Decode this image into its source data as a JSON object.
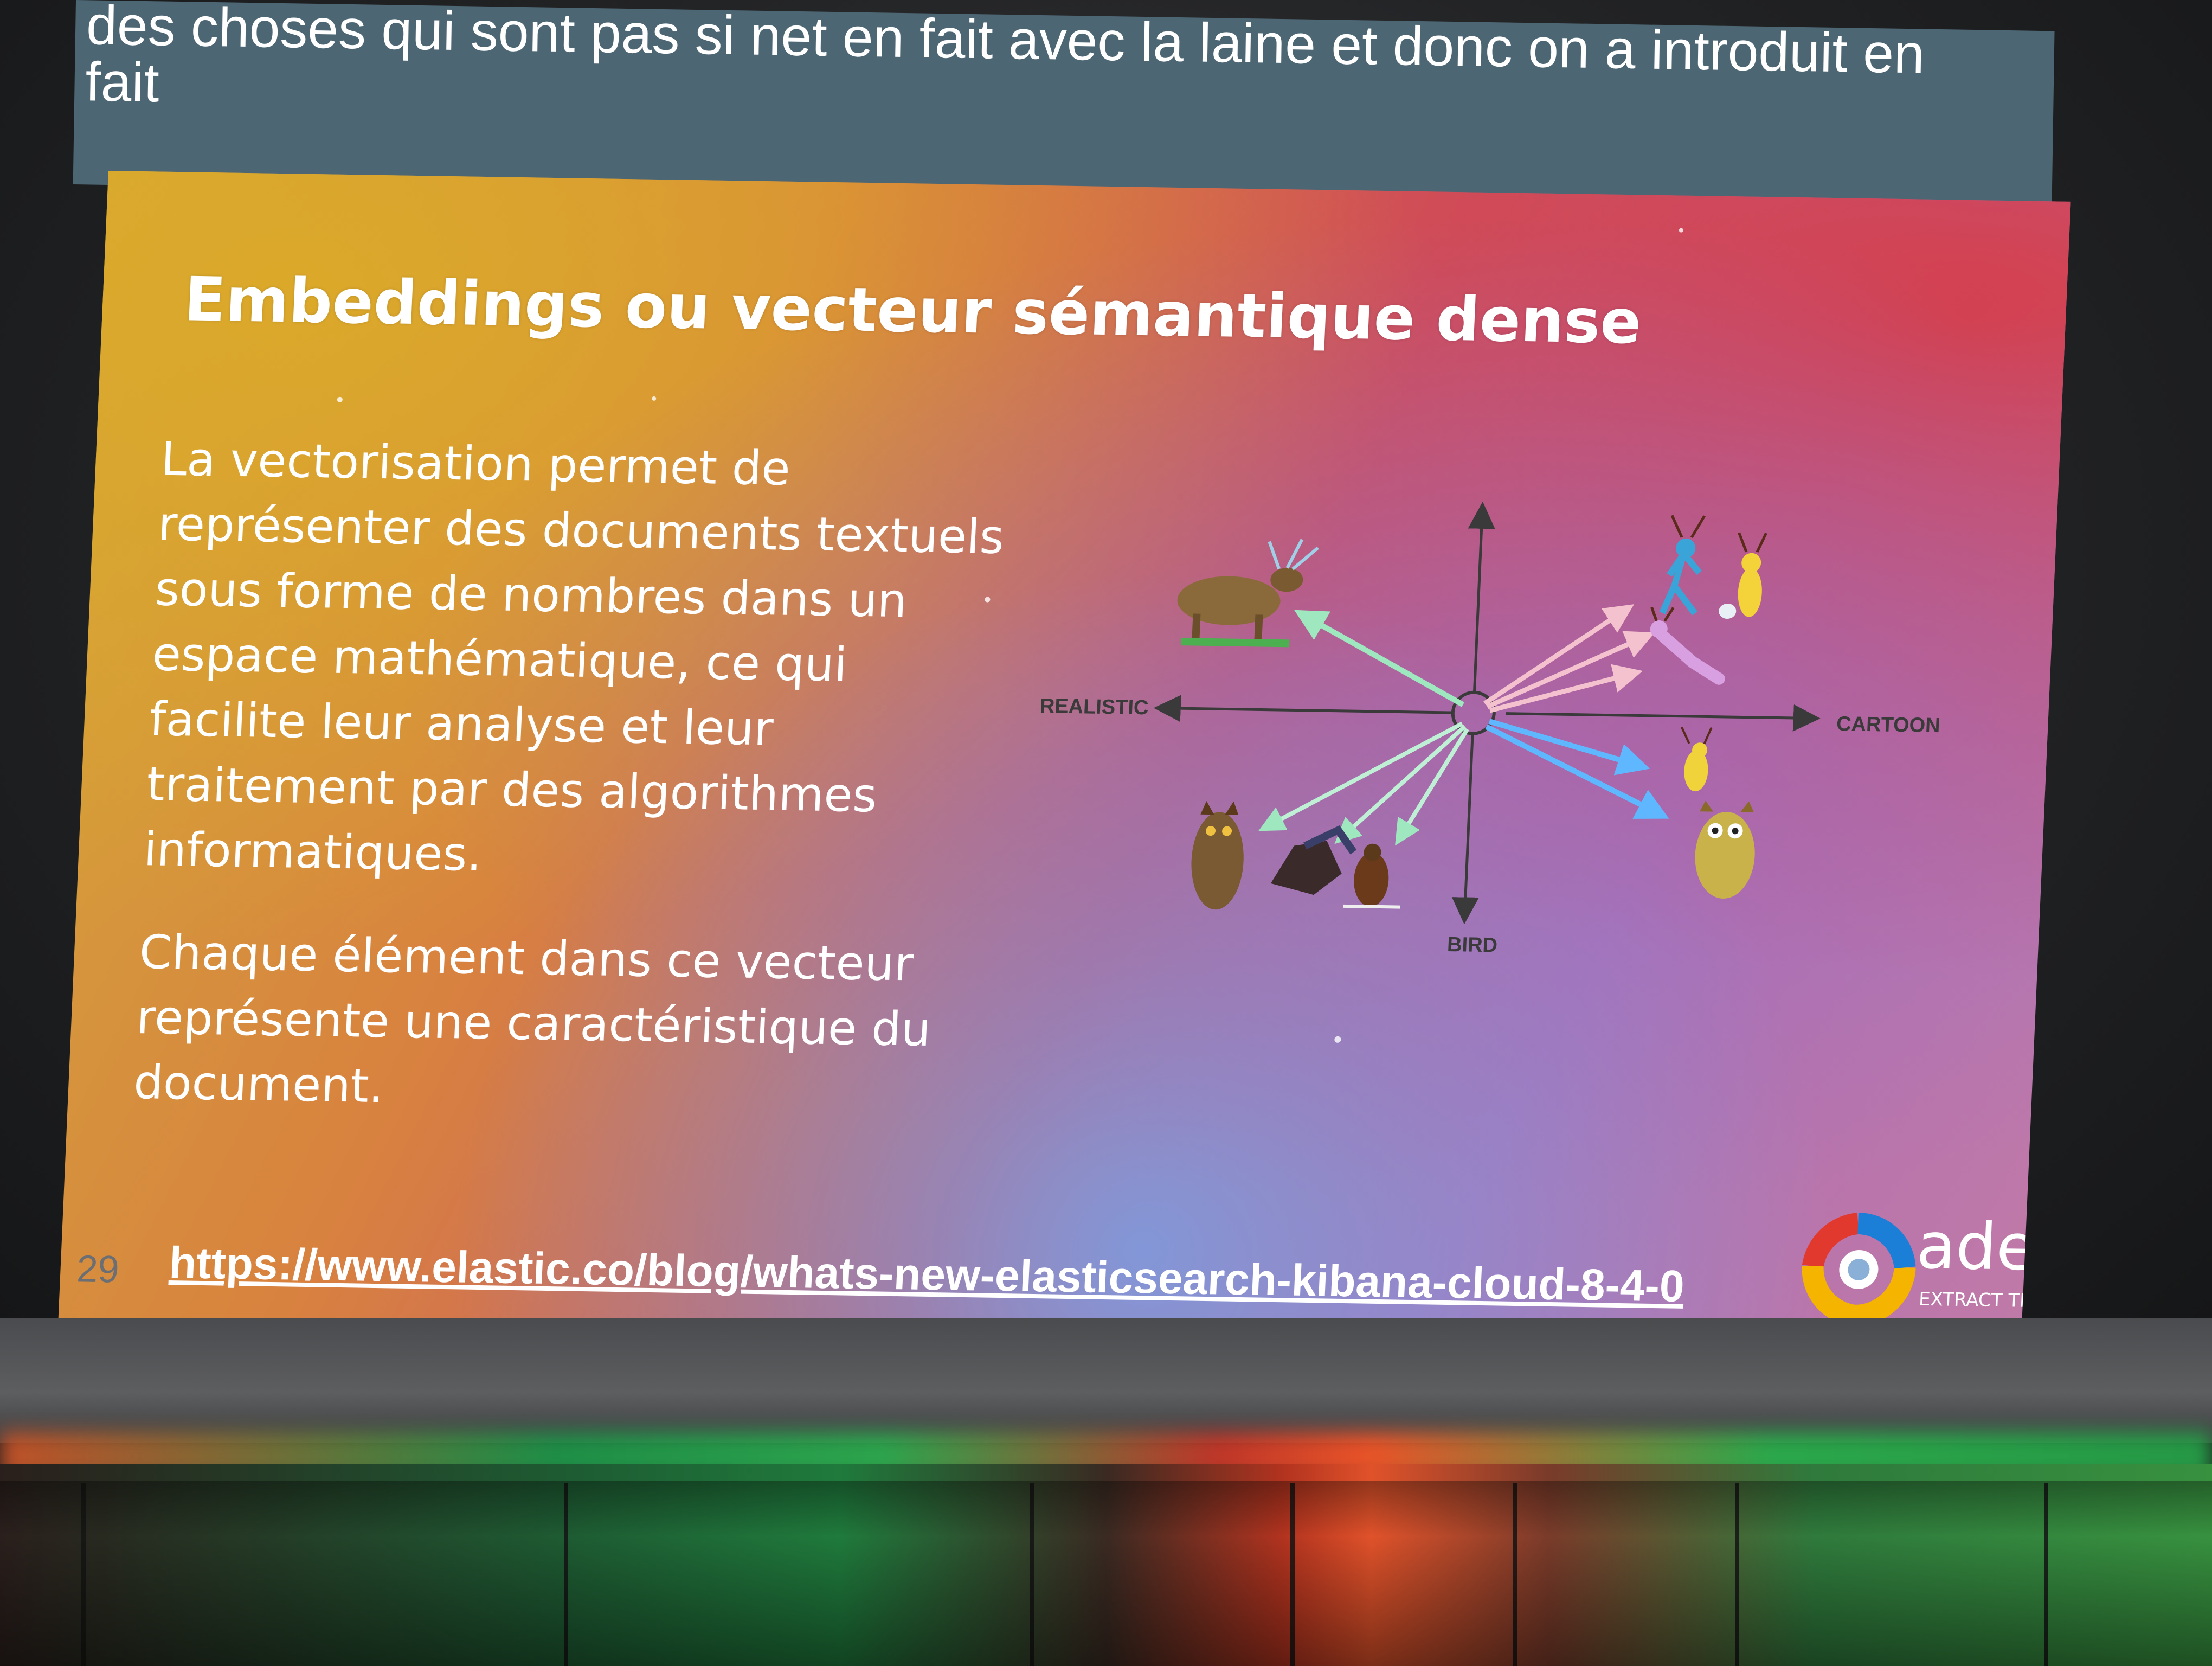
{
  "subtitle": {
    "line1": "des choses qui sont pas si net en fait avec la laine et donc on a introduit en",
    "line2": "fait"
  },
  "slide": {
    "title": "Embeddings ou vecteur sémantique dense",
    "paragraph1": "La vectorisation permet de représenter des documents textuels sous forme de nombres dans un espace mathématique, ce qui facilite leur analyse et leur traitement par des algorithmes informatiques.",
    "paragraph2": "Chaque élément dans ce vecteur représente une caractéristique du document.",
    "slide_number": "29",
    "link": "https://www.elastic.co/blog/whats-new-elasticsearch-kibana-cloud-8-4-0",
    "diagram": {
      "left_label": "REALISTIC",
      "right_label": "CARTOON",
      "bottom_label": "BIRD",
      "colors": {
        "green_arrow": "#8fe0b0",
        "pink_arrow": "#f2b8c6",
        "blue_arrow": "#5fb8ff",
        "axis": "#3a3a3a"
      }
    },
    "logo": {
      "name": "adelean",
      "tagline": "EXTRACT TRANSFORM SEARCH",
      "colors": [
        "#e2392f",
        "#1b7fd8",
        "#f4b400",
        "#ffffff"
      ]
    }
  }
}
